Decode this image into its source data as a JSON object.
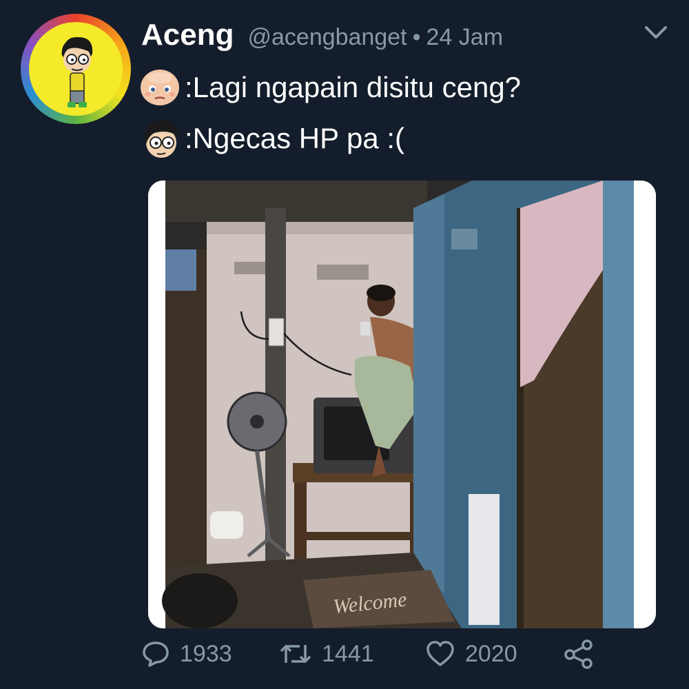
{
  "tweet": {
    "display_name": "Aceng",
    "handle": "@acengbanget",
    "separator": "•",
    "time": "24 Jam",
    "lines": [
      {
        "emoji": "boss-baby-face-icon",
        "text": ":Lagi ngapain disitu ceng?"
      },
      {
        "emoji": "aceng-face-icon",
        "text": ":Ngecas HP pa :("
      }
    ]
  },
  "photo": {
    "mat_text": "Welcome"
  },
  "actions": {
    "replies": "1933",
    "retweets": "1441",
    "likes": "2020"
  },
  "icons": {
    "avatar": "aceng-cartoon-avatar",
    "menu": "chevron-down-icon",
    "reply": "speech-bubble-icon",
    "retweet": "retweet-arrows-icon",
    "like": "heart-icon",
    "share": "share-nodes-icon"
  },
  "colors": {
    "background": "#141d2b",
    "text": "#ffffff",
    "muted": "#8899a6"
  }
}
